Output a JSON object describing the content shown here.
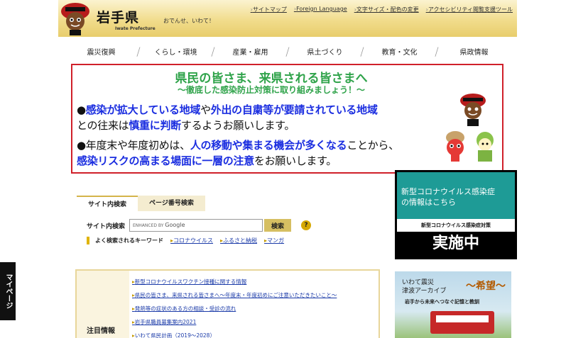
{
  "header": {
    "logo_kanji": "岩手県",
    "logo_en": "Iwate Prefecture",
    "tagline": "おでんせ、いわて！",
    "util_links": [
      "サイトマップ",
      "Foreign Language",
      "文字サイズ・配色の変更",
      "アクセシビリティ閲覧支援ツール"
    ]
  },
  "nav": [
    "震災復興",
    "くらし・環境",
    "産業・雇用",
    "県土づくり",
    "教育・文化",
    "県政情報"
  ],
  "banner": {
    "line1": "県民の皆さま、来県される皆さまへ",
    "line2": "～徹底した感染防止対策に取り組みましょう！～",
    "p1_bullet": "●",
    "p1_a": "感染が拡大している地域",
    "p1_b": "や",
    "p1_c": "外出の自粛等が要請されている地域",
    "p2_a": "との往来は",
    "p2_b": "慎重に判断",
    "p2_c": "するようお願いします。",
    "p3_bullet": "●",
    "p3_a": "年度末や年度初めは、",
    "p3_b": "人の移動や集まる機会が多くなる",
    "p3_c": "ことから、",
    "p4_a": "感染リスクの高まる場面に一層の注意",
    "p4_b": "をお願いします。"
  },
  "covid": {
    "line1": "新型コロナウイルス感染症",
    "line2": "の情報はこちら",
    "mid": "新型コロナウイルス感染症対策",
    "bottom": "実施中"
  },
  "search": {
    "tab_site": "サイト内検索",
    "tab_page": "ページ番号検索",
    "label": "サイト内検索",
    "enhanced": "ENHANCED BY",
    "google": "Google",
    "button": "検索",
    "help": "?",
    "kw_label": "よく検索されるキーワード",
    "keywords": [
      "コロナウイルス",
      "ふるさと納税",
      "マンガ"
    ]
  },
  "notice": {
    "title": "注目情報",
    "items": [
      "新型コロナウイルスワクチン接種に関する情報",
      "県民の皆さま、来県される皆さまへ～年度末・年度初めにご注意いただきたいこと～",
      "発熱等の症状のある方の相談・受診の流れ",
      "岩手県職員募集案内2021",
      "いわて県民計画（2019～2028）"
    ]
  },
  "archive": {
    "line1": "いわて震災",
    "line2": "津波アーカイブ",
    "hope": "～希望～",
    "sub": "岩手から未来へつなぐ記憶と教訓"
  },
  "sidetab": "マイページ"
}
